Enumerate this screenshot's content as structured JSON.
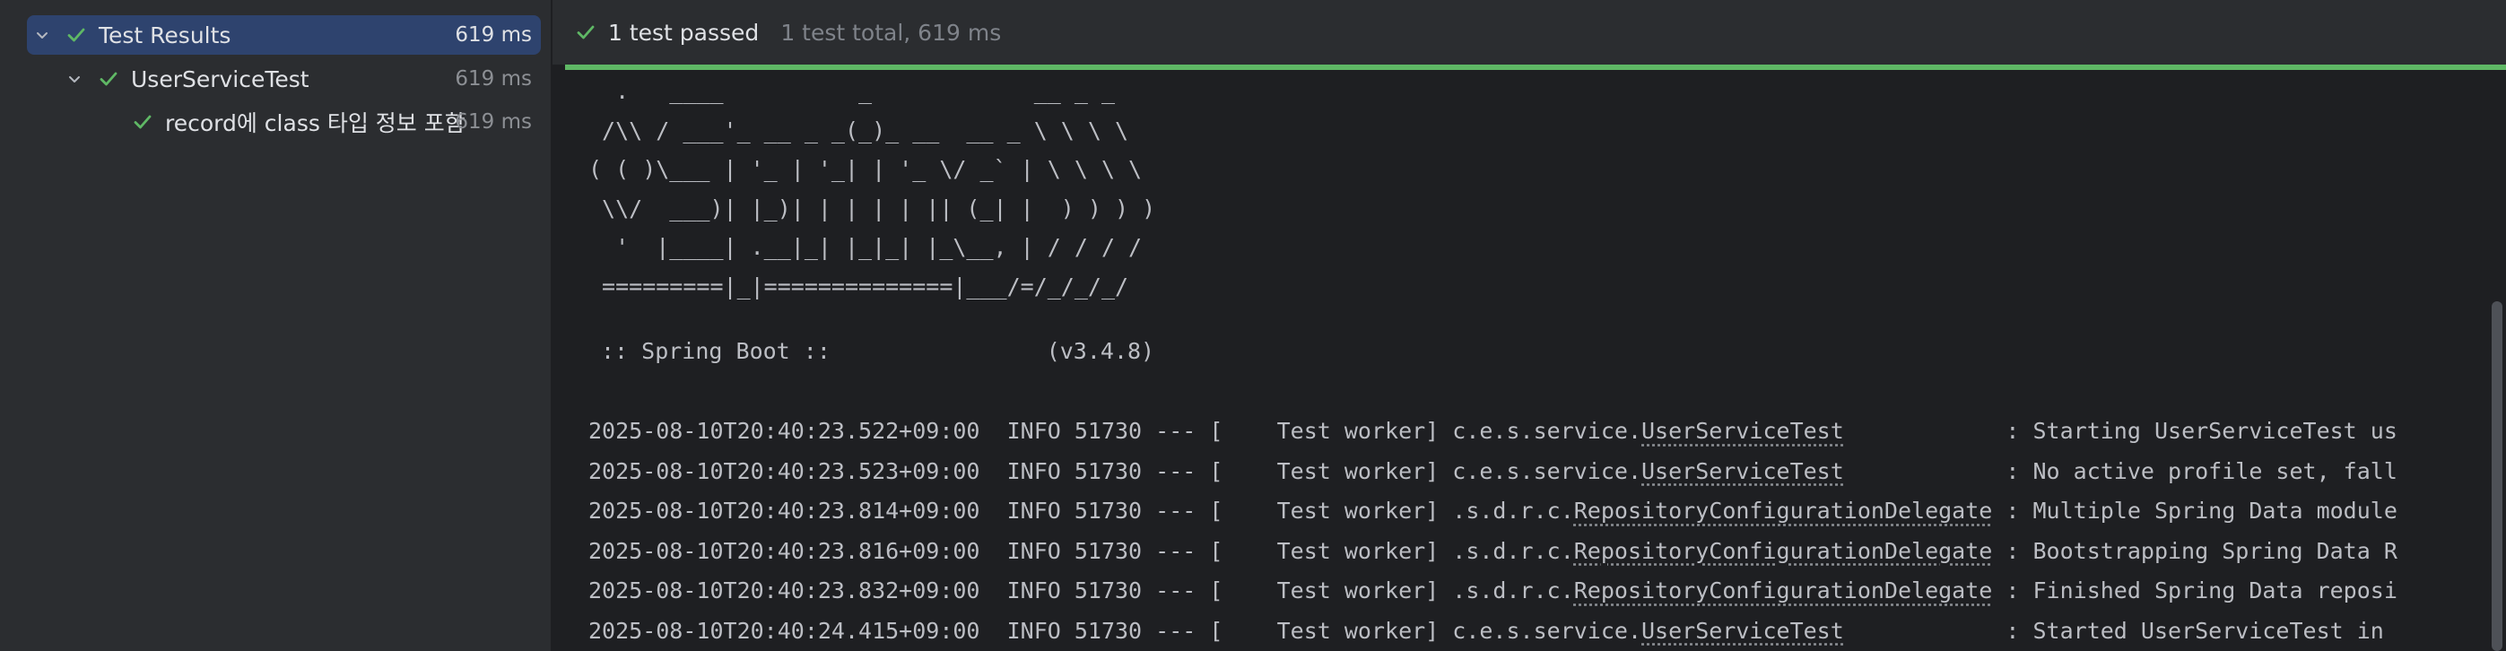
{
  "tree": {
    "rows": [
      {
        "label": "Test Results",
        "time": "619 ms"
      },
      {
        "label": "UserServiceTest",
        "time": "619 ms"
      },
      {
        "label": "record에 class 타입 정보 포함",
        "time": "619 ms"
      }
    ]
  },
  "status": {
    "main": "1 test passed",
    "sub": "1 test total, 619 ms",
    "progress": 1.0
  },
  "console": {
    "banner": [
      "  .   ____          _            __ _ _",
      " /\\\\ / ___'_ __ _ _(_)_ __  __ _ \\ \\ \\ \\",
      "( ( )\\___ | '_ | '_| | '_ \\/ _` | \\ \\ \\ \\",
      " \\\\/  ___)| |_)| | | | | || (_| |  ) ) ) )",
      "  '  |____| .__|_| |_|_| |_\\__, | / / / /",
      " =========|_|==============|___/=/_/_/_/"
    ],
    "boot_line": ":: Spring Boot ::                (v3.4.8)",
    "logs": [
      {
        "prefix": "2025-08-10T20:40:23.522+09:00  INFO 51730 --- [    Test worker] c.e.s.service.",
        "cls": "UserServiceTest",
        "suffix": "            : Starting UserServiceTest us"
      },
      {
        "prefix": "2025-08-10T20:40:23.523+09:00  INFO 51730 --- [    Test worker] c.e.s.service.",
        "cls": "UserServiceTest",
        "suffix": "            : No active profile set, fall"
      },
      {
        "prefix": "2025-08-10T20:40:23.814+09:00  INFO 51730 --- [    Test worker] .s.d.r.c.",
        "cls": "RepositoryConfigurationDelegate",
        "suffix": " : Multiple Spring Data module"
      },
      {
        "prefix": "2025-08-10T20:40:23.816+09:00  INFO 51730 --- [    Test worker] .s.d.r.c.",
        "cls": "RepositoryConfigurationDelegate",
        "suffix": " : Bootstrapping Spring Data R"
      },
      {
        "prefix": "2025-08-10T20:40:23.832+09:00  INFO 51730 --- [    Test worker] .s.d.r.c.",
        "cls": "RepositoryConfigurationDelegate",
        "suffix": " : Finished Spring Data reposi"
      },
      {
        "prefix": "2025-08-10T20:40:24.415+09:00  INFO 51730 --- [    Test worker] c.e.s.service.",
        "cls": "UserServiceTest",
        "suffix": "            : Started UserServiceTest in "
      }
    ]
  },
  "colors": {
    "pass_green": "#5fb865",
    "selection": "#2e436e"
  }
}
